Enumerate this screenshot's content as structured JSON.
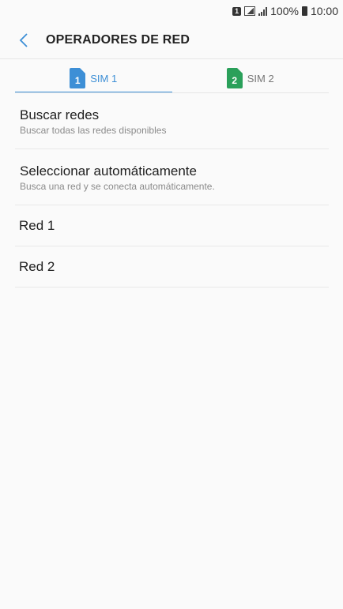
{
  "status": {
    "sim_indicator": "1",
    "battery": "100%",
    "time": "10:00"
  },
  "header": {
    "title": "OPERADORES DE RED"
  },
  "tabs": [
    {
      "label": "SIM 1",
      "sim_number": "1",
      "color": "#3d8fd6",
      "active": true
    },
    {
      "label": "SIM 2",
      "sim_number": "2",
      "color": "#2aa05a",
      "active": false
    }
  ],
  "list": [
    {
      "primary": "Buscar redes",
      "secondary": "Buscar todas las redes disponibles"
    },
    {
      "primary": "Seleccionar automáticamente",
      "secondary": "Busca una red y se conecta automáticamente."
    },
    {
      "primary": "Red 1"
    },
    {
      "primary": "Red 2"
    }
  ],
  "icons": {
    "back": "chevron-left-icon",
    "sim": "sim-card-icon"
  }
}
